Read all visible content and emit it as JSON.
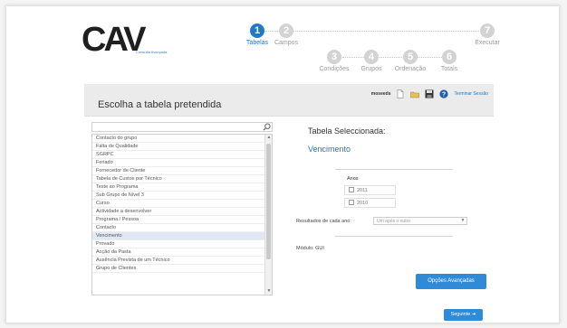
{
  "logo": {
    "text": "CAV",
    "tagline": "Consulta Avançada"
  },
  "wizard": {
    "steps": [
      {
        "num": "1",
        "label": "Tabelas",
        "active": true
      },
      {
        "num": "2",
        "label": "Campos",
        "active": false
      },
      {
        "num": "3",
        "label": "Condições",
        "active": false
      },
      {
        "num": "4",
        "label": "Grupos",
        "active": false
      },
      {
        "num": "5",
        "label": "Ordenação",
        "active": false
      },
      {
        "num": "6",
        "label": "Totais",
        "active": false
      },
      {
        "num": "7",
        "label": "Executar",
        "active": false
      }
    ]
  },
  "header": {
    "title": "Escolha a tabela pretendida",
    "user": "moseeds",
    "logout": "Terminar Sessão"
  },
  "search": {
    "placeholder": "",
    "value": ""
  },
  "tables": [
    "Contacto do grupo",
    "Falta de Qualidade",
    "SGRPC",
    "Feriado",
    "Fornecedor de Cliente",
    "Tabela de Custos por Técnico",
    "Teste ao Programa",
    "Sub Grupo de Nível 3",
    "Curso",
    "Actividade a desenvolver",
    "Programa / Pessoa",
    "Contacto",
    "Vencimento",
    "Provado",
    "Acção da Pasta",
    "Ausência Prevista de um Técnico",
    "Grupo de Clientes"
  ],
  "selected_index": 12,
  "selection": {
    "title": "Tabela Seleccionada:",
    "value": "Vencimento",
    "years_label": "Anos",
    "years": [
      "2011",
      "2010"
    ],
    "results_label": "Resultados de cada ano:",
    "results_option": "Um após o outro",
    "module": "Módulo: GUI"
  },
  "buttons": {
    "advanced": "Opções Avançadas",
    "next": "Seguinte"
  },
  "colors": {
    "accent": "#1f78c8",
    "button": "#2f8ad8",
    "inactive_step": "#d3d3d3"
  }
}
